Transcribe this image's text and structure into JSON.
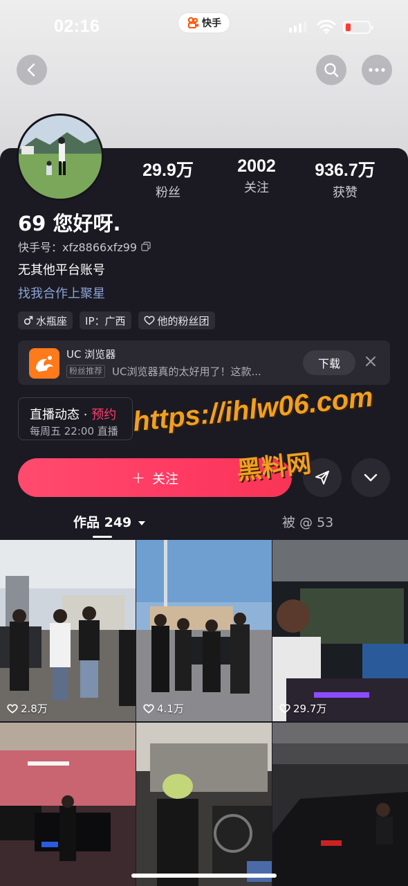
{
  "status_bar": {
    "time": "02:16",
    "app_name": "快手"
  },
  "profile": {
    "name": "69 您好呀.",
    "kuaishou_id": "快手号：xfz8866xfz99",
    "bio": "无其他平台账号",
    "cooperation_link": "找我合作上聚星",
    "stats": [
      {
        "value": "29.9万",
        "label": "粉丝"
      },
      {
        "value": "2002",
        "label": "关注"
      },
      {
        "value": "936.7万",
        "label": "获赞"
      }
    ],
    "tags": [
      {
        "label": "水瓶座",
        "icon": "male-icon"
      },
      {
        "label": "IP：广西",
        "icon": ""
      },
      {
        "label": "他的粉丝团",
        "icon": "heart-icon"
      }
    ]
  },
  "ad": {
    "title": "UC 浏览器",
    "badge": "粉丝推荐",
    "description": "UC浏览器真的太好用了！这款...",
    "button": "下载"
  },
  "live": {
    "title": "直播动态",
    "separator": "·",
    "reserve": "预约",
    "schedule": "每周五 22:00 直播"
  },
  "actions": {
    "follow": "关注",
    "follow_icon": "+"
  },
  "watermark": {
    "url": "https://ihlw06.com",
    "name": "黑料网"
  },
  "tabs": {
    "works": "作品 249",
    "mentioned": "被 @ 53"
  },
  "videos": [
    {
      "likes": "2.8万"
    },
    {
      "likes": "4.1万"
    },
    {
      "likes": "29.7万"
    },
    {
      "likes": ""
    },
    {
      "likes": ""
    },
    {
      "likes": ""
    }
  ],
  "colors": {
    "background": "#1b1a22",
    "accent": "#ff3a63",
    "link": "#8ba3d6",
    "watermark": "#f0a020"
  }
}
